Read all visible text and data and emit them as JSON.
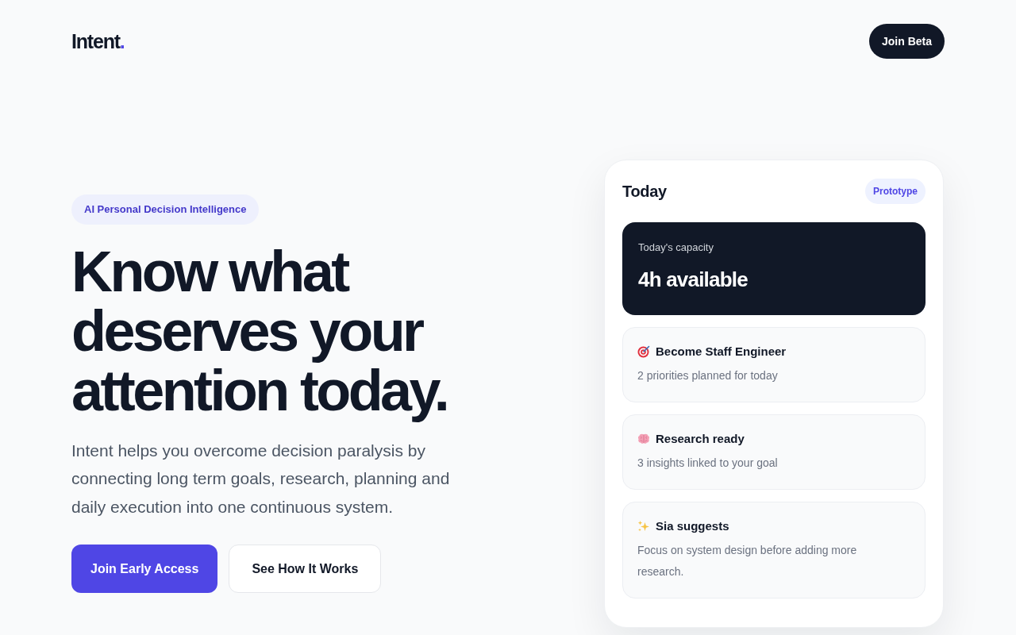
{
  "header": {
    "logo": {
      "text": "Intent",
      "accent": "."
    },
    "button": "Join Beta"
  },
  "hero": {
    "badge": "AI Personal Decision Intelligence",
    "heading": "Know what deserves your attention today.",
    "description": "Intent helps you overcome decision paralysis by connecting long term goals, research, planning and daily execution into one continuous system.",
    "buttons": [
      {
        "label": "Join Early Access",
        "kind": "primary"
      },
      {
        "label": "See How It Works",
        "kind": "secondary"
      }
    ]
  },
  "preview_card": {
    "title": "Today",
    "badge": "Prototype",
    "capacity": {
      "label": "Today's capacity",
      "value": "4h available"
    },
    "items": [
      {
        "kind": "goal",
        "title": "Become Staff Engineer",
        "description": "2 priorities planned for today"
      },
      {
        "kind": "research",
        "title": "Research ready",
        "description": "3 insights linked to your goal"
      },
      {
        "kind": "suggestion",
        "title": "Sia suggests",
        "description": "Focus on system design before adding more research."
      }
    ]
  }
}
